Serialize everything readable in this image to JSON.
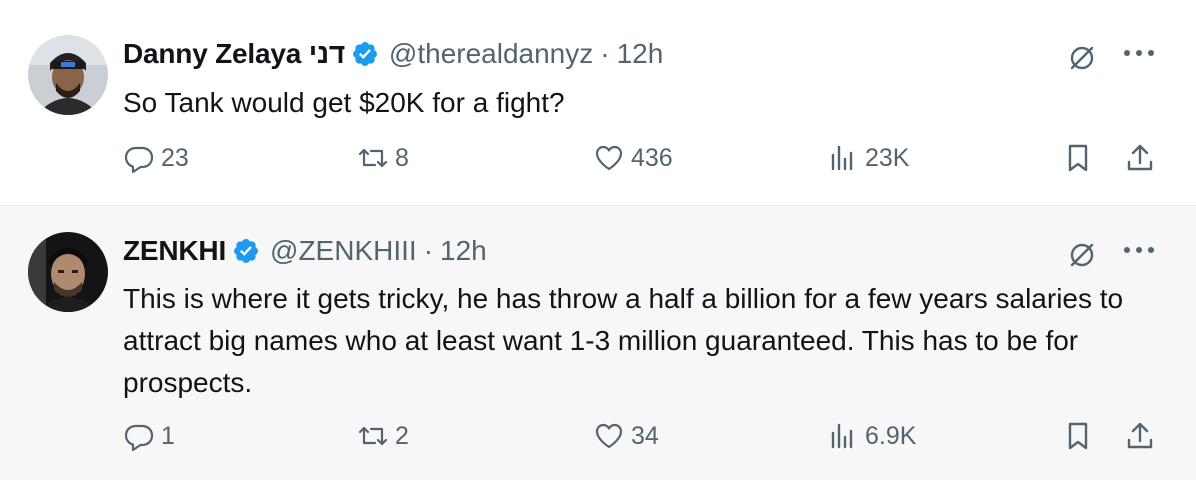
{
  "tweets": [
    {
      "author_name": "Danny Zelaya דני",
      "handle": "@therealdannyz",
      "separator": "·",
      "time": "12h",
      "text": "So Tank would get $20K for a fight?",
      "replies": "23",
      "reposts": "8",
      "likes": "436",
      "views": "23K",
      "verified": true
    },
    {
      "author_name": "ZENKHI",
      "handle": "@ZENKHIII",
      "separator": "·",
      "time": "12h",
      "text": "This is where it gets tricky, he has throw a half a billion for a few years salaries to attract big names who at least want 1-3 million guaranteed. This has to be for prospects.",
      "replies": "1",
      "reposts": "2",
      "likes": "34",
      "views": "6.9K",
      "verified": true
    }
  ],
  "icons": {
    "reply": "reply-icon",
    "repost": "repost-icon",
    "like": "heart-icon",
    "views": "views-icon",
    "bookmark": "bookmark-icon",
    "share": "share-icon",
    "grok": "grok-icon",
    "more": "more-icon",
    "verified": "verified-badge-icon"
  },
  "colors": {
    "verified_blue": "#1d9bf0",
    "text_primary": "#0f1419",
    "text_secondary": "#536471",
    "highlight_bg": "#f7f7f7"
  }
}
